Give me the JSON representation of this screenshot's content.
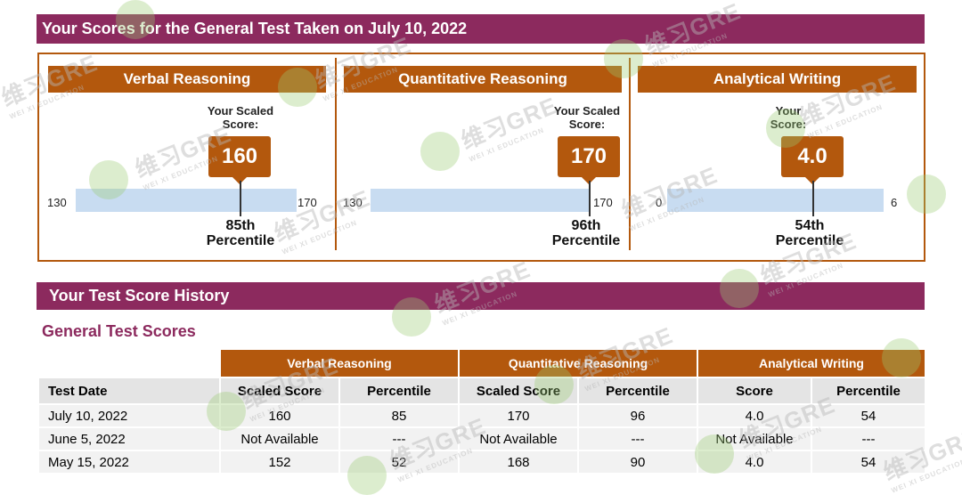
{
  "header": {
    "title": "Your Scores for the General Test Taken on July 10, 2022"
  },
  "sections": [
    {
      "name": "Verbal Reasoning",
      "score_label_line1": "Your Scaled",
      "score_label_line2": "Score:",
      "score": "160",
      "min": "130",
      "max": "170",
      "percentile_num": "85th",
      "percentile_word": "Percentile",
      "fraction": 0.75
    },
    {
      "name": "Quantitative Reasoning",
      "score_label_line1": "Your Scaled",
      "score_label_line2": "Score:",
      "score": "170",
      "min": "130",
      "max": "170",
      "percentile_num": "96th",
      "percentile_word": "Percentile",
      "fraction": 1.0
    },
    {
      "name": "Analytical Writing",
      "score_label_line1": "Your",
      "score_label_line2": "Score:",
      "score": "4.0",
      "min": "0",
      "max": "6",
      "percentile_num": "54th",
      "percentile_word": "Percentile",
      "fraction": 0.667
    }
  ],
  "history": {
    "title": "Your Test Score History",
    "subtitle": "General Test Scores",
    "groups": [
      "Verbal Reasoning",
      "Quantitative Reasoning",
      "Analytical Writing"
    ],
    "columns": [
      "Test Date",
      "Scaled Score",
      "Percentile",
      "Scaled Score",
      "Percentile",
      "Score",
      "Percentile"
    ],
    "rows": [
      [
        "July 10, 2022",
        "160",
        "85",
        "170",
        "96",
        "4.0",
        "54"
      ],
      [
        "June 5, 2022",
        "Not Available",
        "---",
        "Not Available",
        "---",
        "Not Available",
        "---"
      ],
      [
        "May 15, 2022",
        "152",
        "52",
        "168",
        "90",
        "4.0",
        "54"
      ]
    ]
  },
  "watermark": {
    "text": "维习GRE",
    "subtext": "WEI XI EDUCATION"
  },
  "colors": {
    "header_bar": "#8c2a5e",
    "section_header": "#b3580d",
    "scale_bar": "#c8dcf1",
    "subtitle": "#8c2a5e"
  }
}
